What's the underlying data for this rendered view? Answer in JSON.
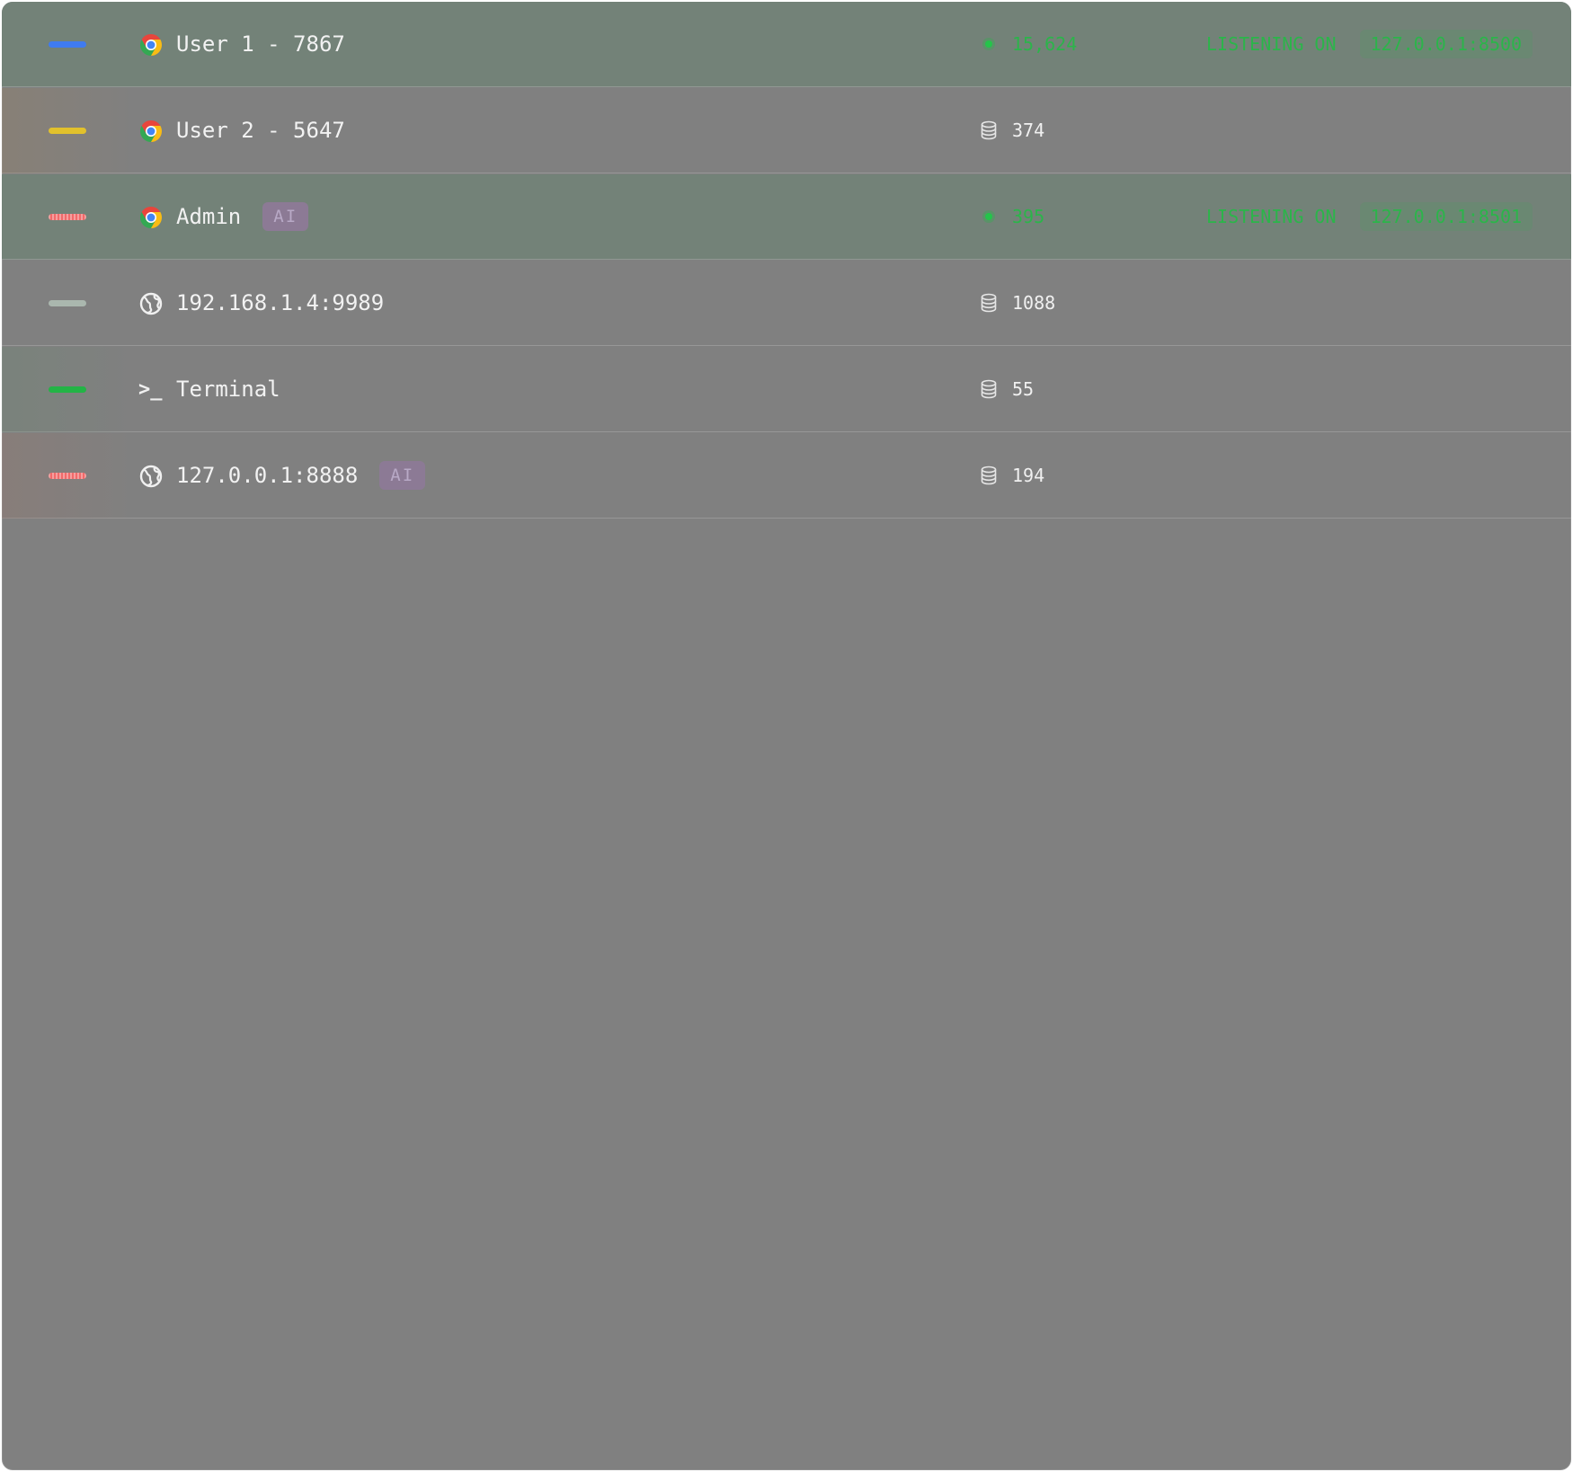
{
  "colors": {
    "blue": "#3f7bf0",
    "yellow": "#e2c12c",
    "red": "#f06a6a",
    "gray": "#aab7ae",
    "green": "#23b446",
    "listening_green": "#2bb54a",
    "active_row_bg": "#738278",
    "panel_bg": "#808080"
  },
  "sessions": [
    {
      "title": "User 1 - 7867",
      "icon": "chrome-icon",
      "swatch": "blue",
      "swatch_style": "solid",
      "ai_badge": "",
      "stat_icon": "live-dot",
      "stat_value": "15,624",
      "status_label": "LISTENING ON",
      "listen_address": "127.0.0.1:8500",
      "active": true
    },
    {
      "title": "User 2 - 5647",
      "icon": "chrome-icon",
      "swatch": "yellow",
      "swatch_style": "solid",
      "ai_badge": "",
      "stat_icon": "database-icon",
      "stat_value": "374",
      "status_label": "",
      "listen_address": "",
      "active": false
    },
    {
      "title": "Admin",
      "icon": "chrome-icon",
      "swatch": "red",
      "swatch_style": "striped",
      "ai_badge": "AI",
      "stat_icon": "live-dot",
      "stat_value": "395",
      "status_label": "LISTENING ON",
      "listen_address": "127.0.0.1:8501",
      "active": true
    },
    {
      "title": "192.168.1.4:9989",
      "icon": "globe-icon",
      "swatch": "gray",
      "swatch_style": "solid",
      "ai_badge": "",
      "stat_icon": "database-icon",
      "stat_value": "1088",
      "status_label": "",
      "listen_address": "",
      "active": false
    },
    {
      "title": "Terminal",
      "icon": "terminal-icon",
      "swatch": "green",
      "swatch_style": "solid",
      "ai_badge": "",
      "stat_icon": "database-icon",
      "stat_value": "55",
      "status_label": "",
      "listen_address": "",
      "active": false
    },
    {
      "title": "127.0.0.1:8888",
      "icon": "globe-icon",
      "swatch": "red",
      "swatch_style": "striped",
      "ai_badge": "AI",
      "stat_icon": "database-icon",
      "stat_value": "194",
      "status_label": "",
      "listen_address": "",
      "active": false
    }
  ]
}
